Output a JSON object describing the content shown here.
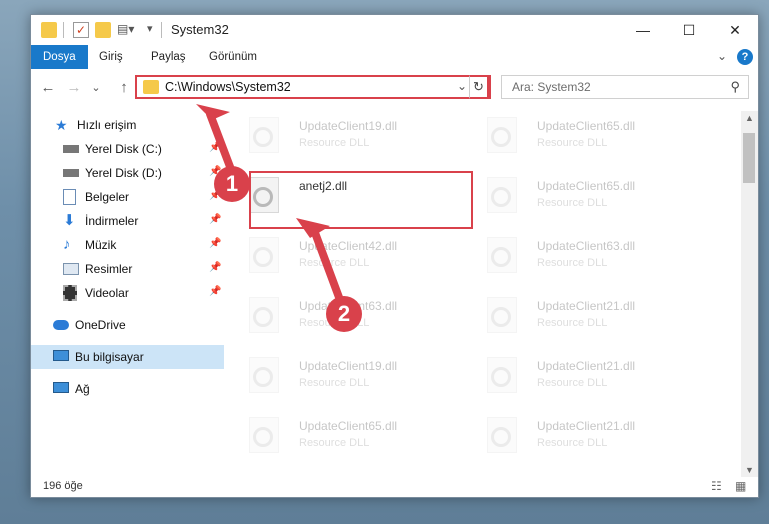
{
  "window": {
    "title": "System32",
    "minimize": "—",
    "maximize": "☐",
    "close": "✕"
  },
  "ribbon": {
    "tabs": [
      "Dosya",
      "Giriş",
      "Paylaş",
      "Görünüm"
    ],
    "active_tab": "Dosya",
    "expand": "⌄",
    "help": "?"
  },
  "address": {
    "path": "C:\\Windows\\System32",
    "dropdown": "⌄",
    "refresh": "↻",
    "search_placeholder": "Ara: System32"
  },
  "nav": {
    "back": "←",
    "forward": "→",
    "recent": "⌄",
    "up": "↑"
  },
  "sidebar": {
    "items": [
      {
        "label": "Hızlı erişim",
        "icon": "star-icon"
      },
      {
        "label": "Yerel Disk (C:)",
        "icon": "drive-icon",
        "pinned": true
      },
      {
        "label": "Yerel Disk (D:)",
        "icon": "drive-icon",
        "pinned": true
      },
      {
        "label": "Belgeler",
        "icon": "documents-icon",
        "pinned": true
      },
      {
        "label": "İndirmeler",
        "icon": "download-icon",
        "pinned": true
      },
      {
        "label": "Müzik",
        "icon": "music-icon",
        "pinned": true
      },
      {
        "label": "Resimler",
        "icon": "pictures-icon",
        "pinned": true
      },
      {
        "label": "Videolar",
        "icon": "videos-icon",
        "pinned": true
      },
      {
        "label": "OneDrive",
        "icon": "cloud-icon"
      },
      {
        "label": "Bu bilgisayar",
        "icon": "computer-icon",
        "selected": true
      },
      {
        "label": "Ağ",
        "icon": "network-icon"
      }
    ]
  },
  "files": {
    "left": [
      {
        "name": "UpdateClient19.dll",
        "type": "Resource DLL"
      },
      {
        "name": "anetj2.dll",
        "type": ""
      },
      {
        "name": "UpdateClient42.dll",
        "type": "Resource DLL"
      },
      {
        "name": "UpdateClient63.dll",
        "type": "Resource DLL"
      },
      {
        "name": "UpdateClient19.dll",
        "type": "Resource DLL"
      },
      {
        "name": "UpdateClient65.dll",
        "type": "Resource DLL"
      }
    ],
    "right": [
      {
        "name": "UpdateClient65.dll",
        "type": "Resource DLL"
      },
      {
        "name": "UpdateClient65.dll",
        "type": "Resource DLL"
      },
      {
        "name": "UpdateClient63.dll",
        "type": "Resource DLL"
      },
      {
        "name": "UpdateClient21.dll",
        "type": "Resource DLL"
      },
      {
        "name": "UpdateClient21.dll",
        "type": "Resource DLL"
      },
      {
        "name": "UpdateClient21.dll",
        "type": "Resource DLL"
      }
    ]
  },
  "status": {
    "count": "196 öğe"
  },
  "annotations": {
    "step1": "1",
    "step2": "2",
    "color": "#d9414b"
  }
}
